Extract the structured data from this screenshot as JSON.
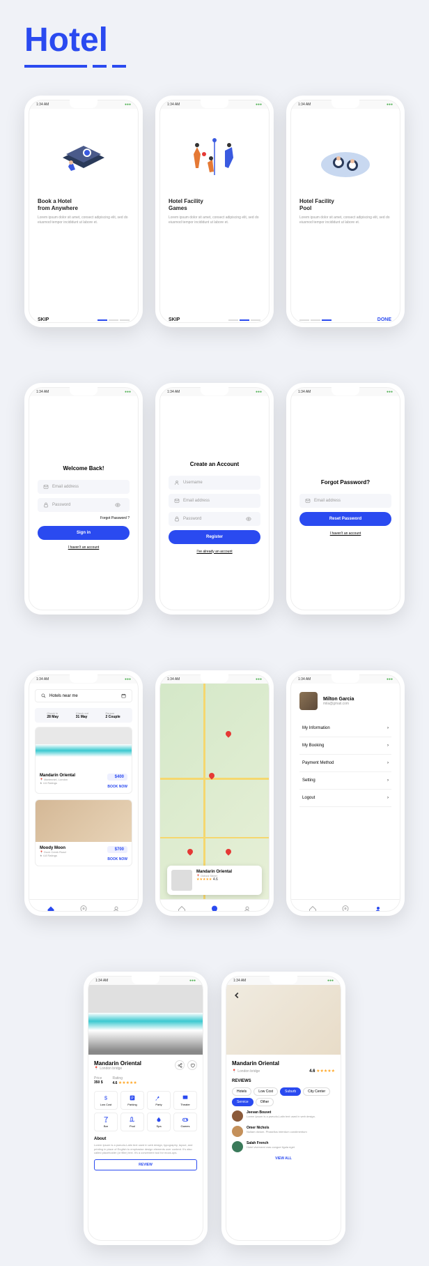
{
  "title": "Hotel",
  "status_time": "1:34 AM",
  "onboard": [
    {
      "title1": "Book a Hotel",
      "title2": "from Anywhere",
      "desc": "Lorem ipsum dolor sit amet, consect adipiscing elit, sed do eiusmod tempor incididunt ut labore et.",
      "skip": "SKIP"
    },
    {
      "title1": "Hotel Facility",
      "title2": "Games",
      "desc": "Lorem ipsum dolor sit amet, consect adipiscing elit, sed do eiusmod tempor incididunt ut labore et.",
      "skip": "SKIP"
    },
    {
      "title1": "Hotel Facility",
      "title2": "Pool",
      "desc": "Lorem ipsum dolor sit amet, consect adipiscing elit, sed do eiusmod tempor incididunt ut labore et.",
      "done": "DONE"
    }
  ],
  "signin": {
    "heading": "Welcome Back!",
    "email": "Email address",
    "password": "Password",
    "forgot": "Forgot Password ?",
    "btn": "Sign in",
    "link": "I haven't an account"
  },
  "signup": {
    "heading": "Create an Account",
    "username": "Username",
    "email": "Email address",
    "password": "Password",
    "btn": "Register",
    "link": "I've already an account"
  },
  "forgotpw": {
    "heading": "Forgot Password?",
    "email": "Email address",
    "btn": "Reset Password",
    "link": "I haven't an account"
  },
  "search": {
    "placeholder": "Hotels near me",
    "ci_l": "Check in",
    "ci_v": "28 May",
    "co_l": "Check out",
    "co_v": "31 May",
    "p_l": "Person",
    "p_v": "2 Couple"
  },
  "hotels": [
    {
      "name": "Mandarin Oriental",
      "loc": "Marlenniel, London",
      "rating": "4.6 Ratings",
      "price": "$400",
      "book": "BOOK NOW"
    },
    {
      "name": "Moody Moon",
      "loc": "Duck Creek Road",
      "rating": "4.8 Ratings",
      "price": "$700",
      "book": "BOOK NOW"
    }
  ],
  "mapcard": {
    "name": "Mandarin Oriental",
    "loc": "Oxford Street",
    "rating": "4.6"
  },
  "profile": {
    "name": "Milton Garcia",
    "email": "mila@gmail.com",
    "menu": [
      "My Information",
      "My Booking",
      "Payment Method",
      "Setting",
      "Logout"
    ]
  },
  "detail": {
    "name": "Mandarin Oriental",
    "loc": "London bridge",
    "price_l": "Price",
    "price_v": "350 $",
    "rating_l": "Rating",
    "rating_v": "4.6",
    "amen": [
      "Low Cost",
      "Parking",
      "Party",
      "Theater",
      "Bar",
      "Pool",
      "Spa",
      "Games"
    ],
    "about_h": "About",
    "about_t": "Lorem Ipsum is a pseudo-Latin text used in web design, typography, layout, and printing in place of English to emphasise design elements over content. It's also called placeholder (or filler) text. It's a convenient tool for mock-ups.",
    "review": "REVIEW"
  },
  "reviews": {
    "name": "Mandarin Oriental",
    "loc": "London bridge",
    "rating": "4.6",
    "heading": "REVIEWS",
    "tags": [
      "Hotels",
      "Low Cost",
      "Suburb",
      "City Center",
      "Service",
      "Other"
    ],
    "items": [
      {
        "name": "Jeevan Bouvet",
        "text": "Lorem Ipsum is a pseudo-Latin text used in web design."
      },
      {
        "name": "Omer Nichols",
        "text": "Nullam dictum. Phasellus interdum condimentum"
      },
      {
        "name": "Salah French",
        "text": "Hotel viverrami cras congue ligula eget"
      }
    ],
    "viewall": "VIEW ALL"
  }
}
